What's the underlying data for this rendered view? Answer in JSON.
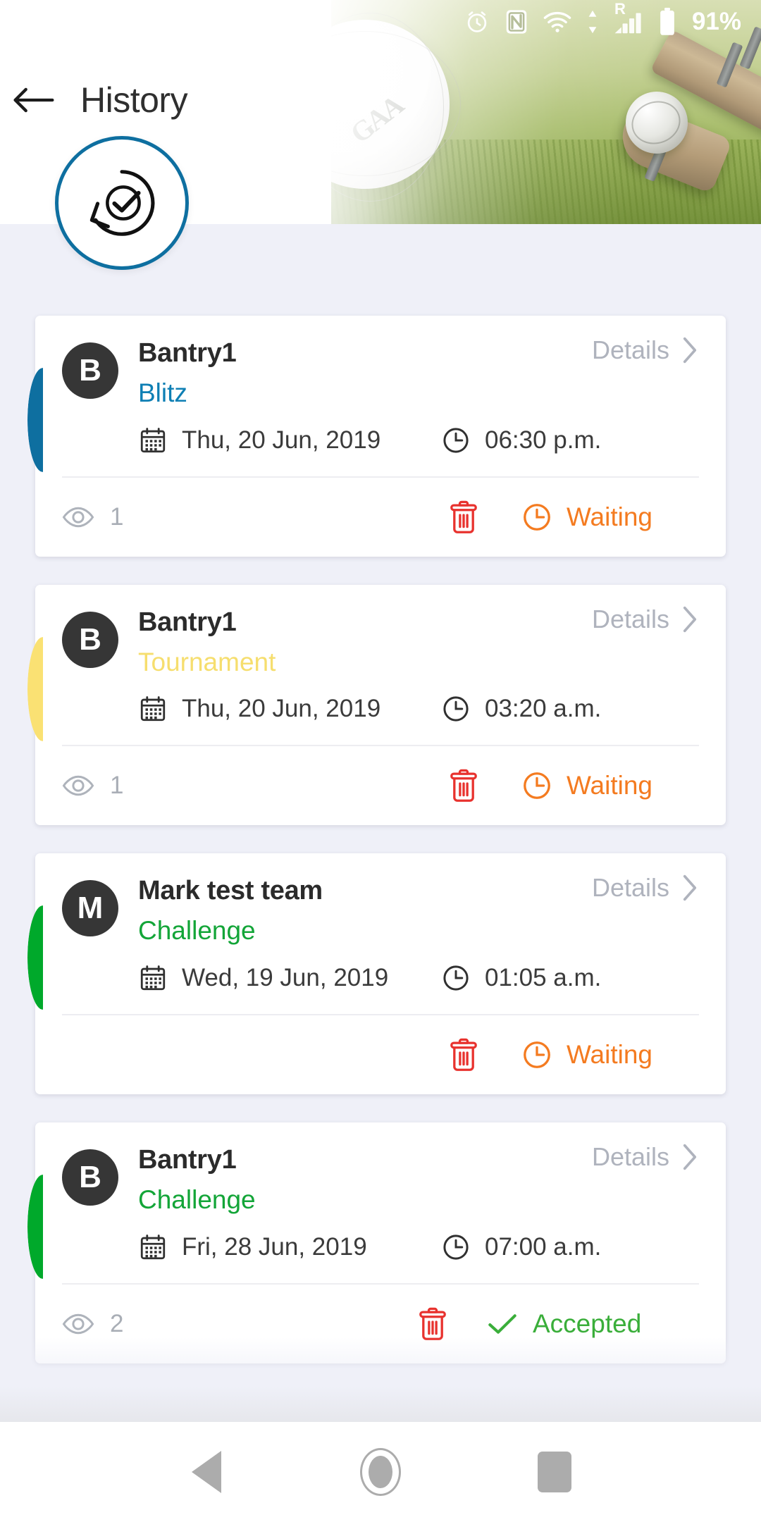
{
  "statusbar": {
    "icons": [
      "alarm-icon",
      "nfc-icon",
      "wifi-icon",
      "data-transfer-icon",
      "roaming-icon",
      "signal-icon",
      "battery-icon"
    ],
    "roaming_label": "R",
    "battery_percent": "91%"
  },
  "header": {
    "title": "History",
    "back_label": "Back",
    "badge_icon": "history-check-icon",
    "badge_border_color": "#0E6FA0"
  },
  "colors": {
    "blitz": "#0E7FB4",
    "tournament": "#F6DE6E",
    "challenge": "#13A538",
    "waiting": "#F47B20",
    "accepted": "#3AAE3A",
    "delete": "#E8322E",
    "details": "#AFB3BD",
    "page_bg": "#EFF0F8"
  },
  "list": {
    "details_label": "Details",
    "cards": [
      {
        "avatar_initial": "B",
        "team": "Bantry1",
        "type": "Blitz",
        "type_color": "#0E7FB4",
        "accent_color": "#0E6FA0",
        "date": "Thu, 20 Jun, 2019",
        "time": "06:30 p.m.",
        "views": "1",
        "has_views": true,
        "status": "Waiting",
        "status_kind": "waiting"
      },
      {
        "avatar_initial": "B",
        "team": "Bantry1",
        "type": "Tournament",
        "type_color": "#F6DE6E",
        "accent_color": "#FAE173",
        "date": "Thu, 20 Jun, 2019",
        "time": "03:20 a.m.",
        "views": "1",
        "has_views": true,
        "status": "Waiting",
        "status_kind": "waiting"
      },
      {
        "avatar_initial": "M",
        "team": "Mark test team",
        "type": "Challenge",
        "type_color": "#13A538",
        "accent_color": "#00A92B",
        "date": "Wed, 19 Jun, 2019",
        "time": "01:05 a.m.",
        "views": "",
        "has_views": false,
        "status": "Waiting",
        "status_kind": "waiting"
      },
      {
        "avatar_initial": "B",
        "team": "Bantry1",
        "type": "Challenge",
        "type_color": "#13A538",
        "accent_color": "#00A92B",
        "date": "Fri, 28 Jun, 2019",
        "time": "07:00 a.m.",
        "views": "2",
        "has_views": true,
        "status": "Accepted",
        "status_kind": "accepted"
      }
    ]
  },
  "navbar": {
    "back": "back-triangle-icon",
    "home": "home-circle-icon",
    "recents": "recents-square-icon"
  }
}
